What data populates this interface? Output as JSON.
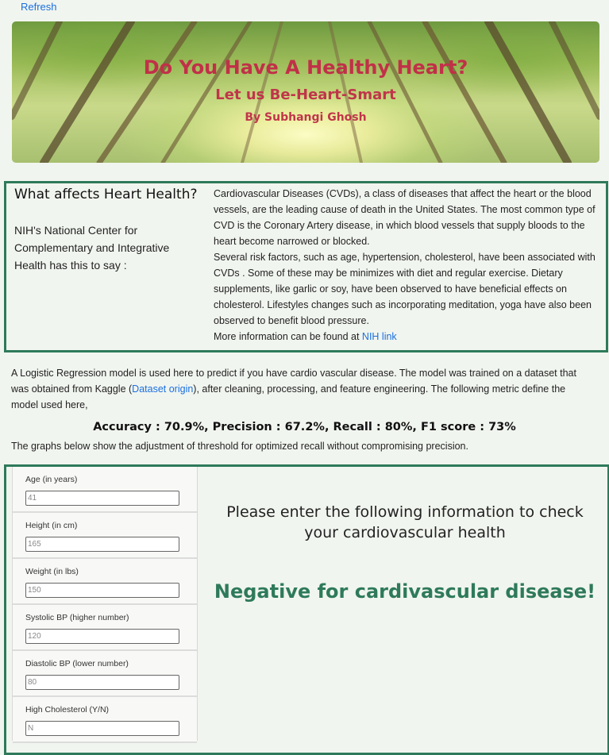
{
  "nav": {
    "refresh_label": "Refresh"
  },
  "banner": {
    "title": "Do You Have A Healthy Heart?",
    "subtitle": "Let us Be-Heart-Smart",
    "author": "By Subhangi Ghosh"
  },
  "info": {
    "heading": "What affects Heart Health?",
    "source_intro": "NIH's National Center for Complementary and Integrative Health has this to say :",
    "paragraph_1": "Cardiovascular Diseases (CVDs), a class of diseases that affect the heart or the blood vessels, are the leading cause of death in the United States. The most common type of CVD is the Coronary Artery disease, in which blood vessels that supply bloods to the heart become narrowed or blocked.",
    "paragraph_2": "Several risk factors, such as age, hypertension, cholesterol, have been associated with CVDs . Some of these may be minimizes with diet and regular exercise. Dietary supplements, like garlic or soy, have been observed to have beneficial effects on cholesterol. Lifestyles changes such as incorporating meditation, yoga have also been observed to benefit blood pressure.",
    "more_prefix": "More information can be found at ",
    "nih_link": "NIH link"
  },
  "model": {
    "desc_before": "A Logistic Regression model is used here to predict if you have cardio vascular disease. The model was trained on a dataset that was obtained from Kaggle (",
    "dataset_link": "Dataset origin",
    "desc_after": "), after cleaning, processing, and feature engineering. The following metric define the model used here,",
    "metrics": "Accuracy : 70.9%, Precision : 67.2%, Recall : 80%, F1 score : 73%",
    "graphs_note": "The graphs below show the adjustment of threshold for optimized recall without compromising precision."
  },
  "form": {
    "fields": [
      {
        "label": "Age (in years)",
        "value": "41"
      },
      {
        "label": "Height (in cm)",
        "value": "165"
      },
      {
        "label": "Weight (in lbs)",
        "value": "150"
      },
      {
        "label": "Systolic BP (higher number)",
        "value": "120"
      },
      {
        "label": "Diastolic BP (lower number)",
        "value": "80"
      },
      {
        "label": "High Cholesterol (Y/N)",
        "value": "N"
      }
    ]
  },
  "panel": {
    "prompt": "Please enter the following information to check your cardiovascular health",
    "result": "Negative for cardivascular disease!"
  },
  "colors": {
    "accent": "#2e7a5a",
    "link": "#1a6fe0",
    "banner_text": "#c0354a"
  }
}
